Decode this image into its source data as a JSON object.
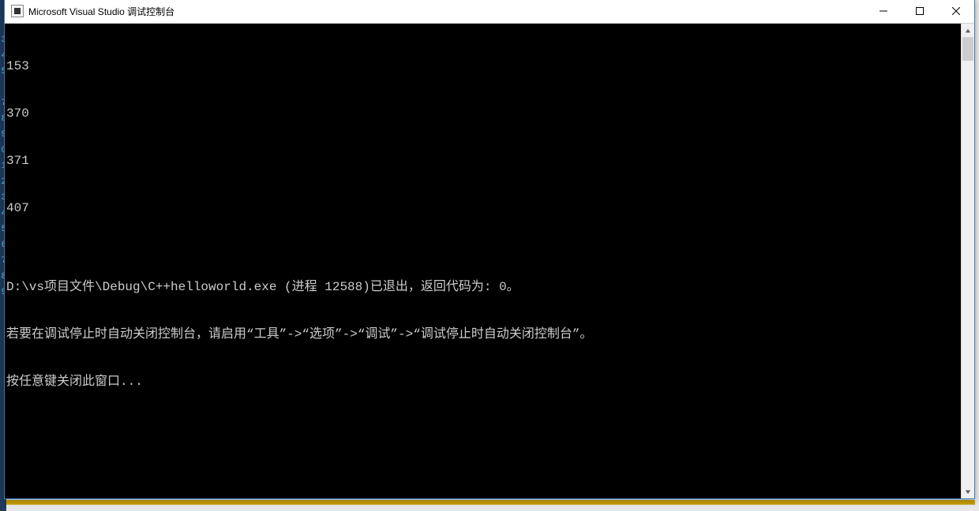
{
  "window": {
    "title": "Microsoft Visual Studio 调试控制台"
  },
  "console": {
    "lines": [
      "153",
      "370",
      "371",
      "407",
      "",
      "D:\\vs项目文件\\Debug\\C++helloworld.exe (进程 12588)已退出，返回代码为: 0。",
      "若要在调试停止时自动关闭控制台，请启用“工具”->“选项”->“调试”->“调试停止时自动关闭控制台”。",
      "按任意键关闭此窗口..."
    ]
  }
}
